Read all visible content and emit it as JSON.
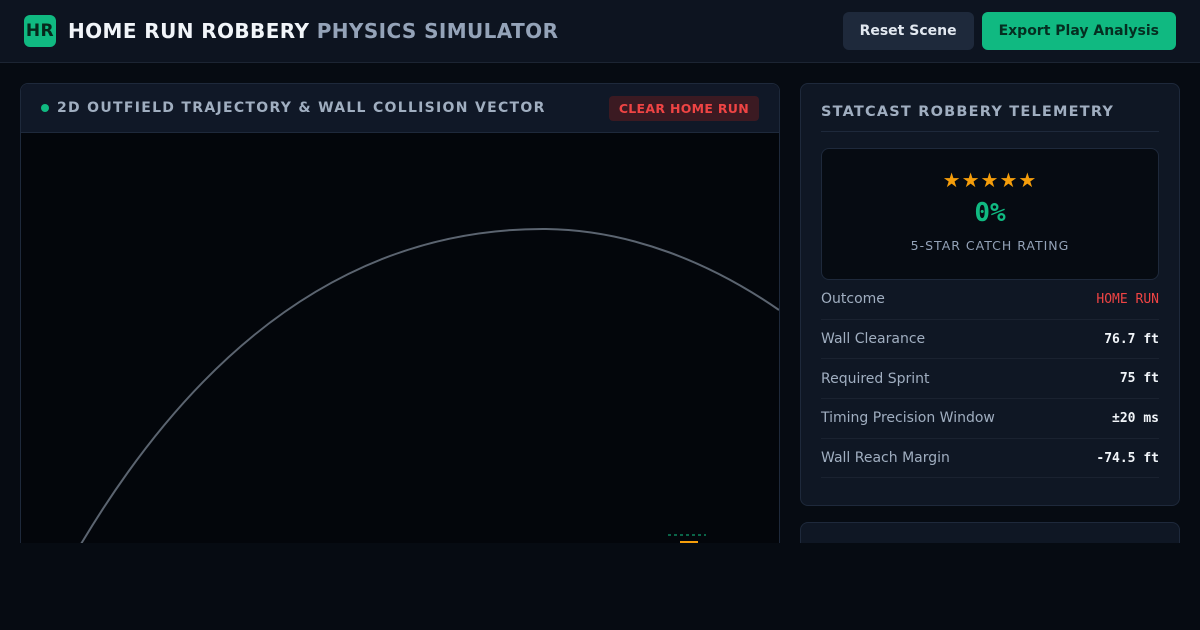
{
  "header": {
    "logo_text": "HR",
    "title_main": "HOME RUN ROBBERY",
    "title_sub": "PHYSICS SIMULATOR",
    "reset_label": "Reset Scene",
    "export_label": "Export Play Analysis"
  },
  "trajectory_panel": {
    "title": "2D OUTFIELD TRAJECTORY & WALL COLLISION VECTOR",
    "status_badge": "CLEAR HOME RUN"
  },
  "telemetry": {
    "title": "STATCAST ROBBERY TELEMETRY",
    "stars": "★★★★★",
    "catch_rating": "0%",
    "catch_rating_label": "5-STAR CATCH RATING",
    "stats": [
      {
        "label": "Outcome",
        "value": "HOME RUN"
      },
      {
        "label": "Wall Clearance",
        "value": "76.7 ft"
      },
      {
        "label": "Required Sprint",
        "value": "75 ft"
      },
      {
        "label": "Timing Precision Window",
        "value": "±20 ms"
      },
      {
        "label": "Wall Reach Margin",
        "value": "-74.5 ft"
      }
    ]
  },
  "colors": {
    "accent": "#10b981",
    "danger": "#ef4444",
    "star": "#f59e0b",
    "background": "#060b12"
  }
}
